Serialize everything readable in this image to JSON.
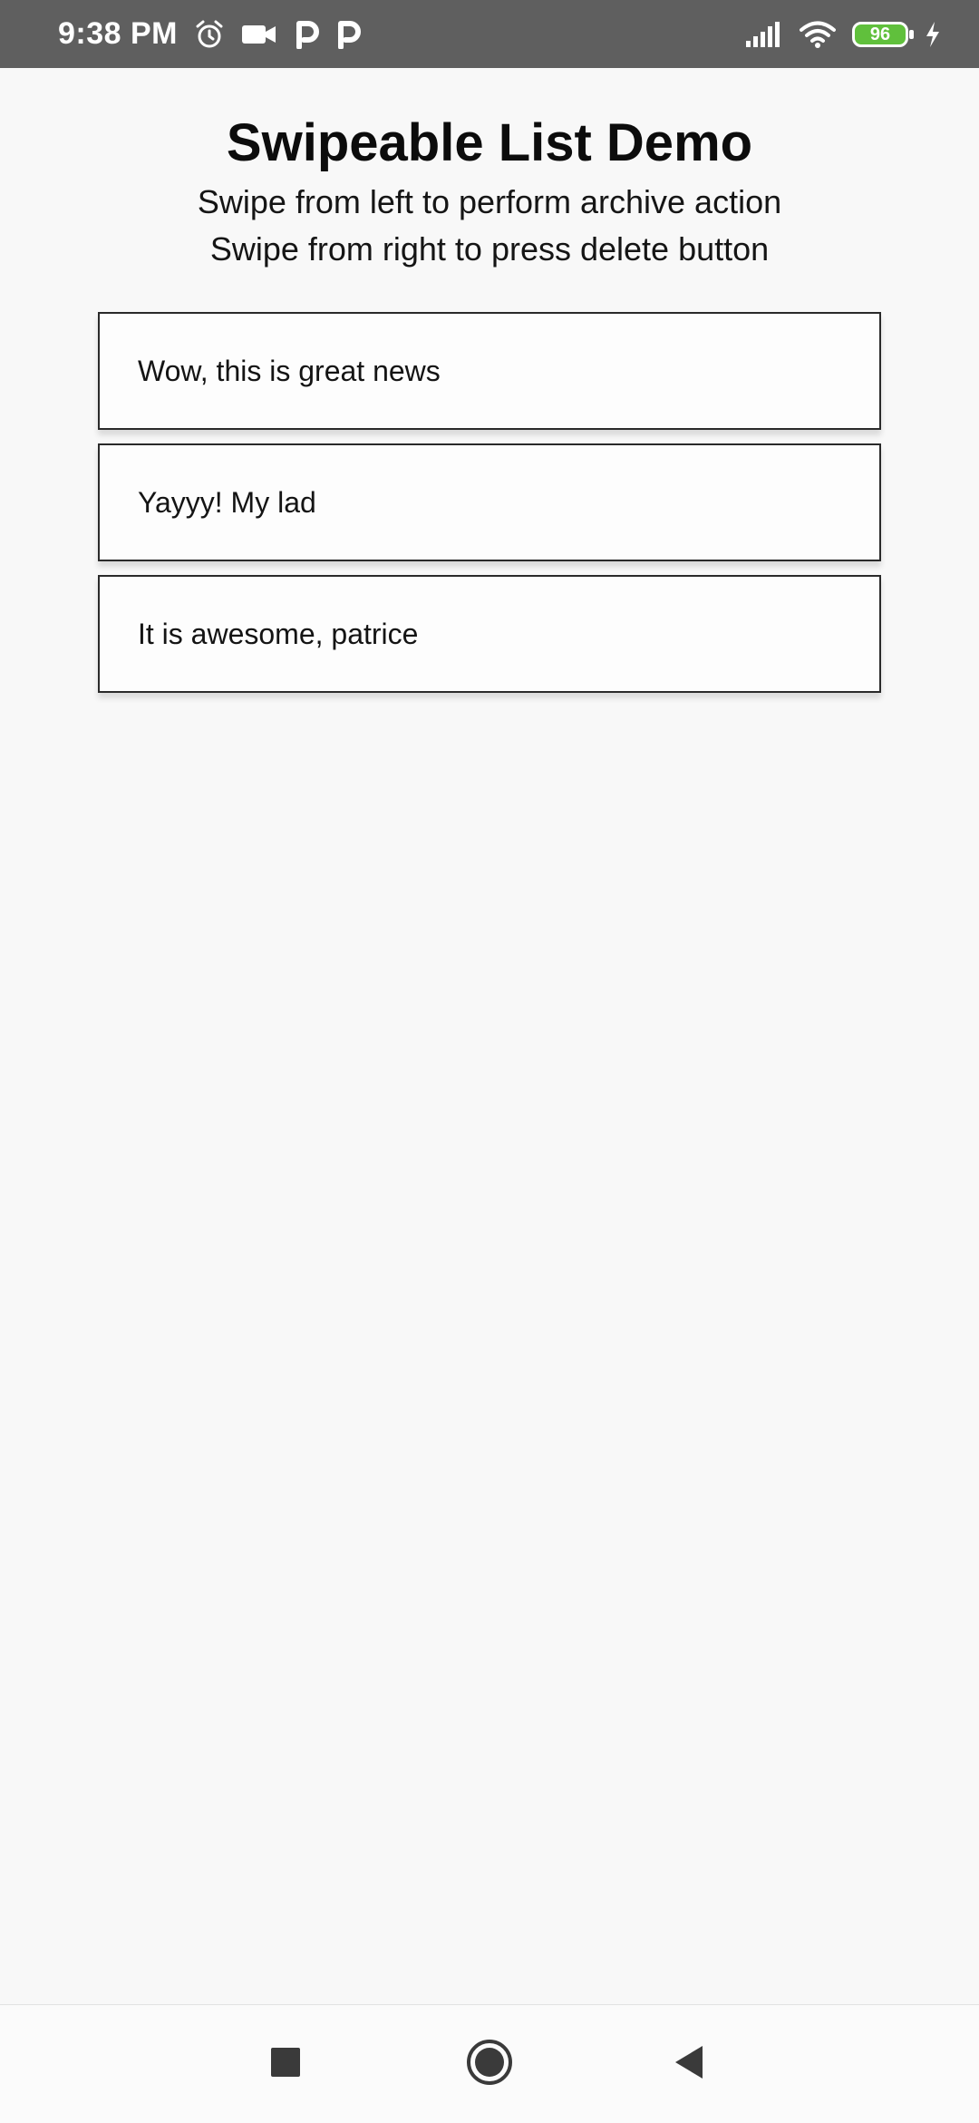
{
  "status_bar": {
    "time": "9:38 PM",
    "battery": "96",
    "icons": [
      "alarm-icon",
      "video-camera-icon",
      "p-app-icon",
      "p-app-icon",
      "signal-icon",
      "wifi-icon",
      "battery-icon",
      "charging-icon"
    ]
  },
  "header": {
    "title": "Swipeable List Demo",
    "subtitle_line1": "Swipe from left to perform archive action",
    "subtitle_line2": "Swipe from right to press delete button"
  },
  "list": {
    "items": [
      {
        "text": "Wow, this is great news"
      },
      {
        "text": "Yayyy! My lad"
      },
      {
        "text": "It is awesome, patrice"
      }
    ]
  },
  "nav_bar": {
    "icons": [
      "recent-apps-icon",
      "home-icon",
      "back-icon"
    ]
  },
  "colors": {
    "status_bar_bg": "#5f5f5f",
    "battery_fill": "#60c03c",
    "background": "#f8f8f8",
    "item_border": "#2a2a2a"
  }
}
